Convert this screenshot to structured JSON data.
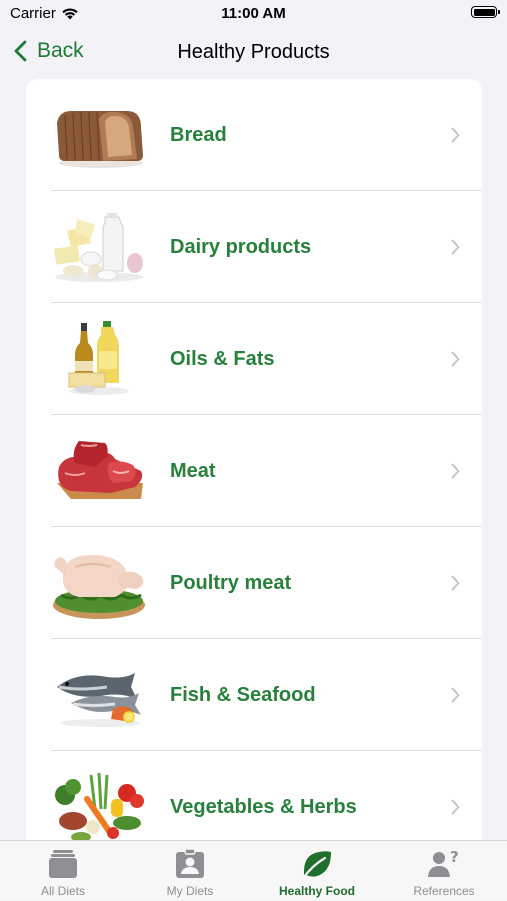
{
  "status_bar": {
    "carrier": "Carrier",
    "time": "11:00 AM"
  },
  "nav": {
    "back_label": "Back",
    "title": "Healthy Products"
  },
  "colors": {
    "accent": "#27813b",
    "tab_active": "#1e6e2c",
    "tab_inactive": "#8e8e93",
    "chevron": "#c4c4c7"
  },
  "list": {
    "items": [
      {
        "label": "Bread",
        "icon": "bread-image"
      },
      {
        "label": "Dairy products",
        "icon": "dairy-image"
      },
      {
        "label": "Oils & Fats",
        "icon": "oils-image"
      },
      {
        "label": "Meat",
        "icon": "meat-image"
      },
      {
        "label": "Poultry meat",
        "icon": "poultry-image"
      },
      {
        "label": "Fish & Seafood",
        "icon": "fish-image"
      },
      {
        "label": "Vegetables & Herbs",
        "icon": "vegetables-image"
      }
    ]
  },
  "tabs": [
    {
      "label": "All Diets",
      "icon": "stack-icon",
      "active": false
    },
    {
      "label": "My Diets",
      "icon": "profile-card-icon",
      "active": false
    },
    {
      "label": "Healthy Food",
      "icon": "leaf-icon",
      "active": true
    },
    {
      "label": "References",
      "icon": "person-question-icon",
      "active": false
    }
  ]
}
